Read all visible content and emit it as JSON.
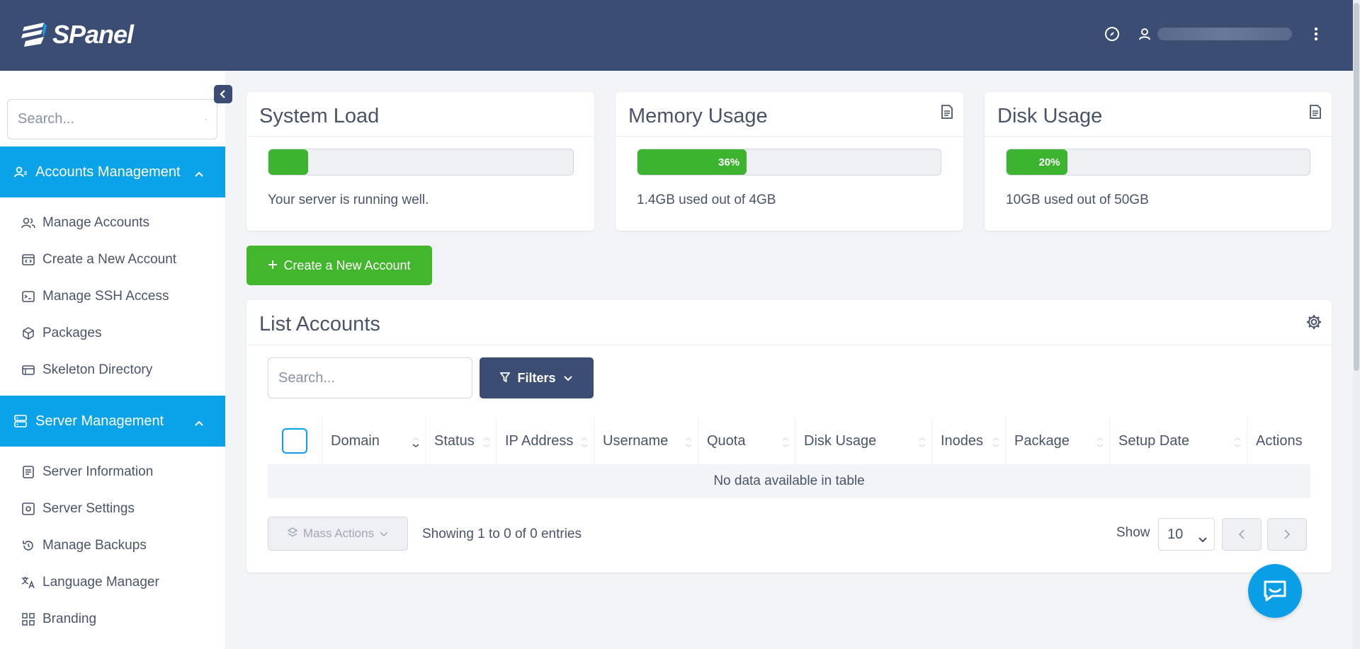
{
  "header": {
    "logo_text": "SPanel",
    "icons": [
      "compass-icon",
      "user-icon",
      "kebab-menu-icon"
    ]
  },
  "sidebar": {
    "search_placeholder": "Search...",
    "sections": [
      {
        "title": "Accounts Management",
        "icon": "accounts-icon",
        "items": [
          {
            "label": "Manage Accounts",
            "icon": "users-icon"
          },
          {
            "label": "Create a New Account",
            "icon": "code-window-icon"
          },
          {
            "label": "Manage SSH Access",
            "icon": "terminal-icon"
          },
          {
            "label": "Packages",
            "icon": "box-icon"
          },
          {
            "label": "Skeleton Directory",
            "icon": "browser-window-icon"
          }
        ]
      },
      {
        "title": "Server Management",
        "icon": "server-icon",
        "items": [
          {
            "label": "Server Information",
            "icon": "document-icon"
          },
          {
            "label": "Server Settings",
            "icon": "settings-box-icon"
          },
          {
            "label": "Manage Backups",
            "icon": "history-icon"
          },
          {
            "label": "Language Manager",
            "icon": "translate-icon"
          },
          {
            "label": "Branding",
            "icon": "branding-icon"
          }
        ]
      }
    ]
  },
  "stats": {
    "system_load": {
      "title": "System Load",
      "percent": 13,
      "label": "",
      "status": "Your server is running well."
    },
    "memory": {
      "title": "Memory Usage",
      "percent": 36,
      "label": "36%",
      "status": "1.4GB used out of 4GB"
    },
    "disk": {
      "title": "Disk Usage",
      "percent": 20,
      "label": "20%",
      "status": "10GB used out of 50GB"
    }
  },
  "create_button": "Create a New Account",
  "list": {
    "title": "List Accounts",
    "search_placeholder": "Search...",
    "filters_label": "Filters",
    "columns": [
      "Domain",
      "Status",
      "IP Address",
      "Username",
      "Quota",
      "Disk Usage",
      "Inodes",
      "Package",
      "Setup Date",
      "Actions"
    ],
    "empty_text": "No data available in table",
    "mass_actions": "Mass Actions",
    "showing": "Showing 1 to 0 of 0 entries",
    "show_label": "Show",
    "page_size": "10"
  },
  "colors": {
    "header_bg": "#3b4d72",
    "accent": "#0aa3ea",
    "success": "#42b62d"
  }
}
